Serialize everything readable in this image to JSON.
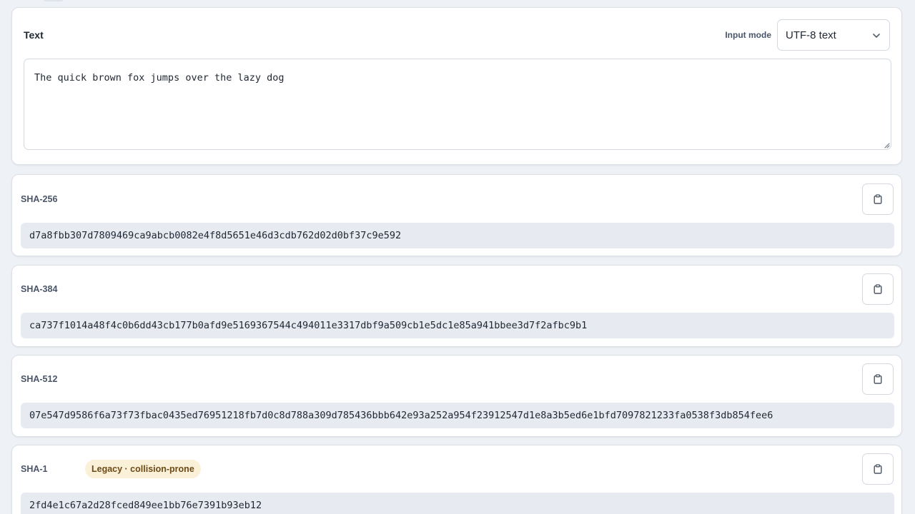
{
  "input": {
    "title": "Text",
    "mode_label": "Input mode",
    "mode_value": "UTF-8 text",
    "text": "The quick brown fox jumps over the lazy dog"
  },
  "hashes": [
    {
      "name": "SHA-256",
      "value": "d7a8fbb307d7809469ca9abcb0082e4f8d5651e46d3cdb762d02d0bf37c9e592"
    },
    {
      "name": "SHA-384",
      "value": "ca737f1014a48f4c0b6dd43cb177b0afd9e5169367544c494011e3317dbf9a509cb1e5dc1e85a941bbee3d7f2afbc9b1"
    },
    {
      "name": "SHA-512",
      "value": "07e547d9586f6a73f73fbac0435ed76951218fb7d0c8d788a309d785436bbb642e93a252a954f23912547d1e8a3b5ed6e1bfd7097821233fa0538f3db854fee6"
    },
    {
      "name": "SHA-1",
      "badge": "Legacy · collision-prone",
      "value": "2fd4e1c67a2d28fced849ee1bb76e7391b93eb12"
    }
  ],
  "icons": {
    "copy": "clipboard-icon",
    "dropdown": "chevron-down-icon"
  },
  "colors": {
    "page_background": "#eef1f5",
    "hash_background": "#e7ebf1",
    "badge_background": "#fbf0d8",
    "badge_text": "#6b4a16"
  }
}
